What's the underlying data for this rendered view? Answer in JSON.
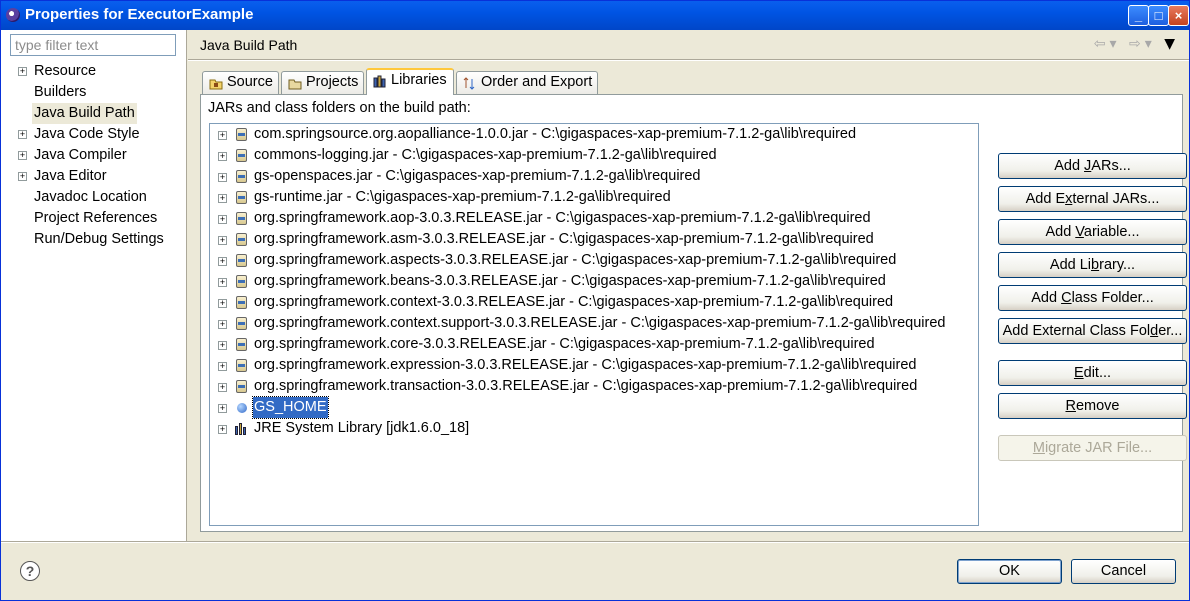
{
  "window": {
    "title": "Properties for ExecutorExample",
    "controls": {
      "minimize": "minimize-icon",
      "maximize": "maximize-icon",
      "close": "close-icon"
    }
  },
  "left": {
    "filter_placeholder": "type filter text",
    "items": [
      {
        "label": "Resource",
        "expandable": true
      },
      {
        "label": "Builders",
        "expandable": false
      },
      {
        "label": "Java Build Path",
        "expandable": false,
        "selected": true
      },
      {
        "label": "Java Code Style",
        "expandable": true
      },
      {
        "label": "Java Compiler",
        "expandable": true
      },
      {
        "label": "Java Editor",
        "expandable": true
      },
      {
        "label": "Javadoc Location",
        "expandable": false
      },
      {
        "label": "Project References",
        "expandable": false
      },
      {
        "label": "Run/Debug Settings",
        "expandable": false
      }
    ]
  },
  "page": {
    "title": "Java Build Path",
    "tabs": [
      {
        "label": "Source",
        "icon": "source-folder-icon"
      },
      {
        "label": "Projects",
        "icon": "projects-icon"
      },
      {
        "label": "Libraries",
        "icon": "libraries-icon",
        "active": true
      },
      {
        "label": "Order and Export",
        "icon": "order-export-icon"
      }
    ],
    "libraries_label": "JARs and class folders on the build path:",
    "entries": [
      {
        "text": "com.springsource.org.aopalliance-1.0.0.jar - C:\\gigaspaces-xap-premium-7.1.2-ga\\lib\\required",
        "icon": "jar"
      },
      {
        "text": "commons-logging.jar - C:\\gigaspaces-xap-premium-7.1.2-ga\\lib\\required",
        "icon": "jar"
      },
      {
        "text": "gs-openspaces.jar - C:\\gigaspaces-xap-premium-7.1.2-ga\\lib\\required",
        "icon": "jar"
      },
      {
        "text": "gs-runtime.jar - C:\\gigaspaces-xap-premium-7.1.2-ga\\lib\\required",
        "icon": "jar"
      },
      {
        "text": "org.springframework.aop-3.0.3.RELEASE.jar - C:\\gigaspaces-xap-premium-7.1.2-ga\\lib\\required",
        "icon": "jar"
      },
      {
        "text": "org.springframework.asm-3.0.3.RELEASE.jar - C:\\gigaspaces-xap-premium-7.1.2-ga\\lib\\required",
        "icon": "jar"
      },
      {
        "text": "org.springframework.aspects-3.0.3.RELEASE.jar - C:\\gigaspaces-xap-premium-7.1.2-ga\\lib\\required",
        "icon": "jar"
      },
      {
        "text": "org.springframework.beans-3.0.3.RELEASE.jar - C:\\gigaspaces-xap-premium-7.1.2-ga\\lib\\required",
        "icon": "jar"
      },
      {
        "text": "org.springframework.context-3.0.3.RELEASE.jar - C:\\gigaspaces-xap-premium-7.1.2-ga\\lib\\required",
        "icon": "jar"
      },
      {
        "text": "org.springframework.context.support-3.0.3.RELEASE.jar - C:\\gigaspaces-xap-premium-7.1.2-ga\\lib\\required",
        "icon": "jar"
      },
      {
        "text": "org.springframework.core-3.0.3.RELEASE.jar - C:\\gigaspaces-xap-premium-7.1.2-ga\\lib\\required",
        "icon": "jar"
      },
      {
        "text": "org.springframework.expression-3.0.3.RELEASE.jar - C:\\gigaspaces-xap-premium-7.1.2-ga\\lib\\required",
        "icon": "jar"
      },
      {
        "text": "org.springframework.transaction-3.0.3.RELEASE.jar - C:\\gigaspaces-xap-premium-7.1.2-ga\\lib\\required",
        "icon": "jar"
      },
      {
        "text": "GS_HOME",
        "icon": "variable",
        "selected": true
      },
      {
        "text": "JRE System Library [jdk1.6.0_18]",
        "icon": "library"
      }
    ],
    "buttons": {
      "add_jars": {
        "pre": "Add ",
        "u": "J",
        "post": "ARs..."
      },
      "add_external_jars": {
        "pre": "Add E",
        "u": "x",
        "post": "ternal JARs..."
      },
      "add_variable": {
        "pre": "Add ",
        "u": "V",
        "post": "ariable..."
      },
      "add_library": {
        "pre": "Add Li",
        "u": "b",
        "post": "rary..."
      },
      "add_class_folder": {
        "pre": "Add ",
        "u": "C",
        "post": "lass Folder..."
      },
      "add_external_class_folder": {
        "pre": "Add External Class Fol",
        "u": "d",
        "post": "er..."
      },
      "edit": {
        "pre": "",
        "u": "E",
        "post": "dit..."
      },
      "remove": {
        "pre": "",
        "u": "R",
        "post": "emove"
      },
      "migrate_jar": {
        "pre": "",
        "u": "M",
        "post": "igrate JAR File..."
      }
    }
  },
  "footer": {
    "help": "?",
    "ok": "OK",
    "cancel": "Cancel"
  }
}
